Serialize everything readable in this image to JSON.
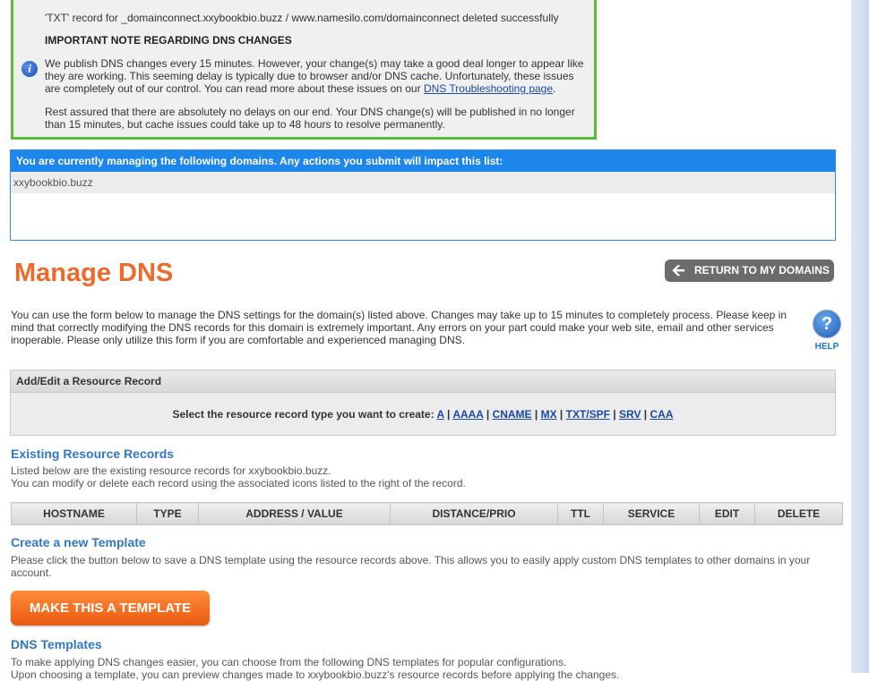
{
  "notice": {
    "deleted_message": "'TXT' record for _domainconnect.xxybookbio.buzz / www.namesilo.com/domainconnect deleted successfully",
    "important_heading": "IMPORTANT NOTE REGARDING DNS CHANGES",
    "para1_line1": "We publish DNS changes every 15 minutes. However, your change(s) may take a good deal longer to appear like",
    "para1_line2": "they are working. This seeming delay is typically due to browser and/or DNS cache. Unfortunately, these issues",
    "para1_line3_prefix": "are completely out of our control. You can read more about these issues on our ",
    "troubleshooting_link": "DNS Troubleshooting page",
    "para1_line3_suffix": ".",
    "para2_line1": "Rest assured that there are absolutely no delays on our end. Your DNS change(s) will be published in no longer",
    "para2_line2": "than 15 minutes, but cache issues could take up to 48 hours to resolve permanently."
  },
  "managing": {
    "header": "You are currently managing the following domains. Any actions you submit will impact this list:",
    "domains": [
      "xxybookbio.buzz"
    ]
  },
  "page_title": "Manage DNS",
  "return_button": "RETURN TO MY DOMAINS",
  "intro": {
    "line1": "You can use the form below to manage the DNS settings for the domain(s) listed above. Changes may take up to 15 minutes to completely process. Please keep in",
    "line2": "mind that correctly modifying the DNS records for this domain is extremely important. Any errors on your part could make your web site, email and other services",
    "line3": "inoperable. Please only utilize this form if you are comfortable and experienced managing DNS."
  },
  "help_label": "HELP",
  "add_edit": {
    "header": "Add/Edit a Resource Record",
    "prompt": "Select the resource record type you want to create: ",
    "types": [
      "A",
      "AAAA",
      "CNAME",
      "MX",
      "TXT/SPF",
      "SRV",
      "CAA"
    ]
  },
  "existing": {
    "title": "Existing Resource Records",
    "line1": "Listed below are the existing resource records for xxybookbio.buzz.",
    "line2": "You can modify or delete each record using the associated icons listed to the right of the record.",
    "columns": [
      "HOSTNAME",
      "TYPE",
      "ADDRESS / VALUE",
      "DISTANCE/PRIO",
      "TTL",
      "SERVICE",
      "EDIT",
      "DELETE"
    ]
  },
  "template": {
    "title": "Create a new Template",
    "line1": "Please click the button below to save a DNS template using the resource records above. This allows you to easily apply custom DNS templates to other domains in your",
    "line2": "account.",
    "button": "MAKE THIS A TEMPLATE"
  },
  "dns_templates": {
    "title": "DNS Templates",
    "line1": "To make applying DNS changes easier, you can choose from the following DNS templates for popular configurations.",
    "line2": "Upon choosing a template, you can preview changes made to xxybookbio.buzz's resource records before applying the changes."
  },
  "colors": {
    "accent_orange": "#ee6a2c",
    "link_blue": "#1a48a8",
    "header_blue": "#1d86ea",
    "success_green": "#5dbb3a"
  }
}
